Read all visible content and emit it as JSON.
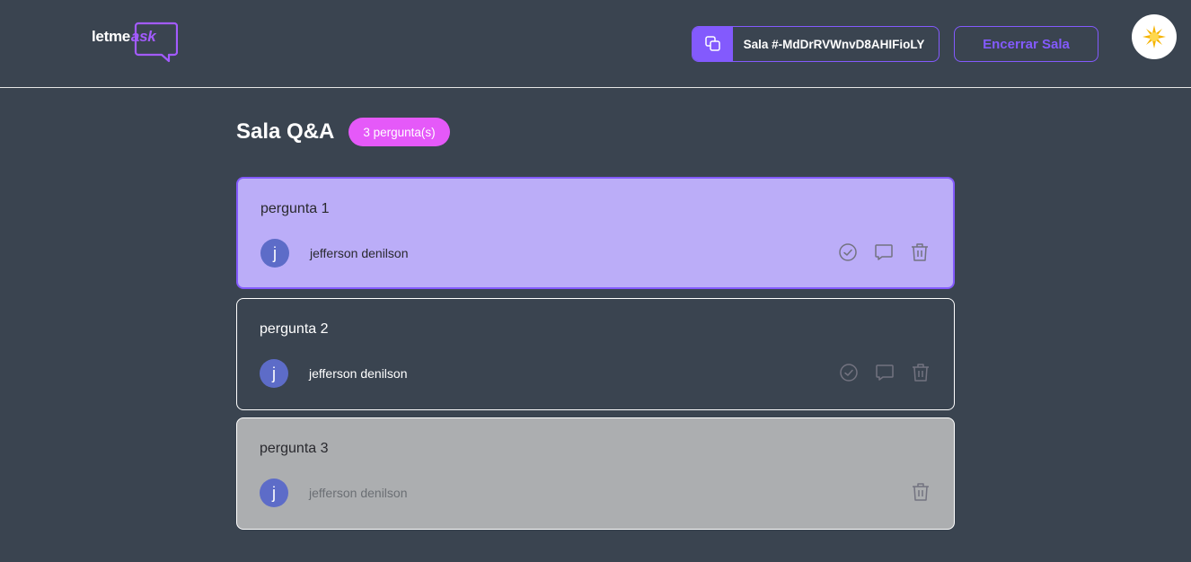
{
  "header": {
    "logo": {
      "text_main": "letme",
      "text_accent": "ask"
    },
    "room_code": {
      "label": "Sala #-MdDrRVWnvD8AHIFioLY",
      "icon": "copy-icon"
    },
    "end_room_label": "Encerrar Sala",
    "theme_toggle": {
      "icon": "sun-icon"
    }
  },
  "room": {
    "title": "Sala Q&A",
    "question_count": "3 pergunta(s)"
  },
  "questions": [
    {
      "content": "pergunta 1",
      "author": {
        "initial": "j",
        "name": "jefferson denilson"
      },
      "state": "highlighted",
      "actions": [
        "check-circle-icon",
        "answer-icon",
        "trash-icon"
      ]
    },
    {
      "content": "pergunta 2",
      "author": {
        "initial": "j",
        "name": "jefferson denilson"
      },
      "state": "default",
      "actions": [
        "check-circle-icon",
        "answer-icon",
        "trash-icon"
      ]
    },
    {
      "content": "pergunta 3",
      "author": {
        "initial": "j",
        "name": "jefferson denilson"
      },
      "state": "answered",
      "actions": [
        "trash-icon"
      ]
    }
  ],
  "colors": {
    "background": "#3a4450",
    "accent": "#835afd",
    "badge": "#e559f9",
    "highlight": "#bbadf8",
    "answered": "#acaeb0",
    "avatar": "#5d6cc8"
  }
}
